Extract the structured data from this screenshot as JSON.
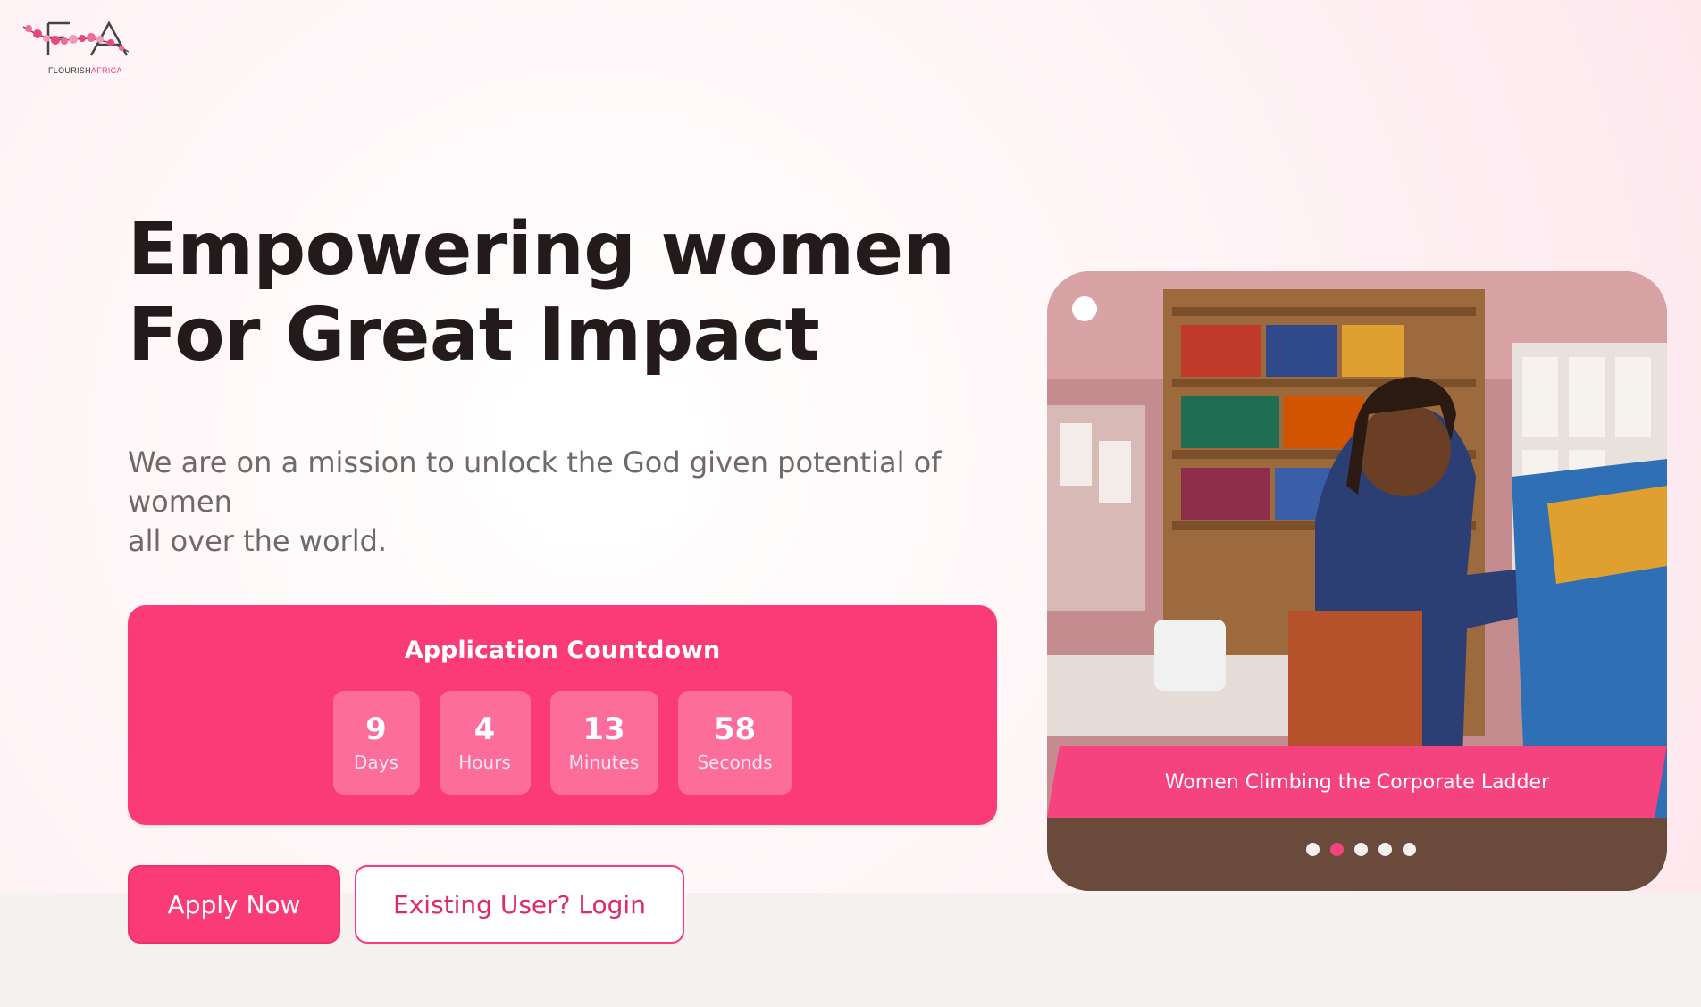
{
  "logo": {
    "monogram": "FA",
    "wordmark_main": "FLOURISH",
    "wordmark_accent": "AFRICA"
  },
  "hero": {
    "headline_lines": [
      "Empowering women",
      "For Great Impact"
    ],
    "mission_lines": [
      "We are on a mission to unlock the God given potential of",
      "women",
      "all over the world."
    ]
  },
  "countdown": {
    "title": "Application Countdown",
    "units": [
      {
        "value": "9",
        "label": "Days"
      },
      {
        "value": "4",
        "label": "Hours"
      },
      {
        "value": "13",
        "label": "Minutes"
      },
      {
        "value": "58",
        "label": "Seconds"
      }
    ]
  },
  "actions": {
    "apply_label": "Apply Now",
    "login_label": "Existing User? Login"
  },
  "carousel": {
    "caption": "Women Climbing the Corporate Ladder",
    "slide_count": 5,
    "active_index": 1
  },
  "colors": {
    "brand_pink": "#fb3a78",
    "headline": "#231a1c",
    "body_text": "#6f6a6a"
  }
}
